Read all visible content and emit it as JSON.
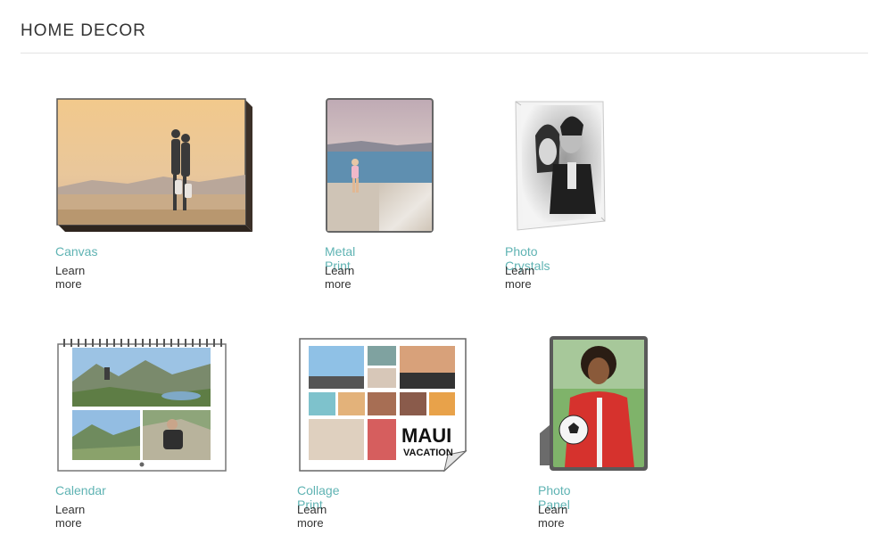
{
  "header": {
    "title": "HOME DECOR"
  },
  "products": [
    {
      "name": "Canvas",
      "link": "Learn more"
    },
    {
      "name": "Metal Print",
      "link": "Learn more"
    },
    {
      "name": "Photo Crystals",
      "link": "Learn more"
    },
    {
      "name": "Calendar",
      "link": "Learn more"
    },
    {
      "name": "Collage Print",
      "link": "Learn more"
    },
    {
      "name": "Photo Panel",
      "link": "Learn more"
    }
  ],
  "collage": {
    "overlay_text_1": "MAUI",
    "overlay_text_2": "VACATION"
  },
  "colors": {
    "accent": "#5fb3b3",
    "text": "#333333",
    "divider": "#e3e3e3"
  }
}
